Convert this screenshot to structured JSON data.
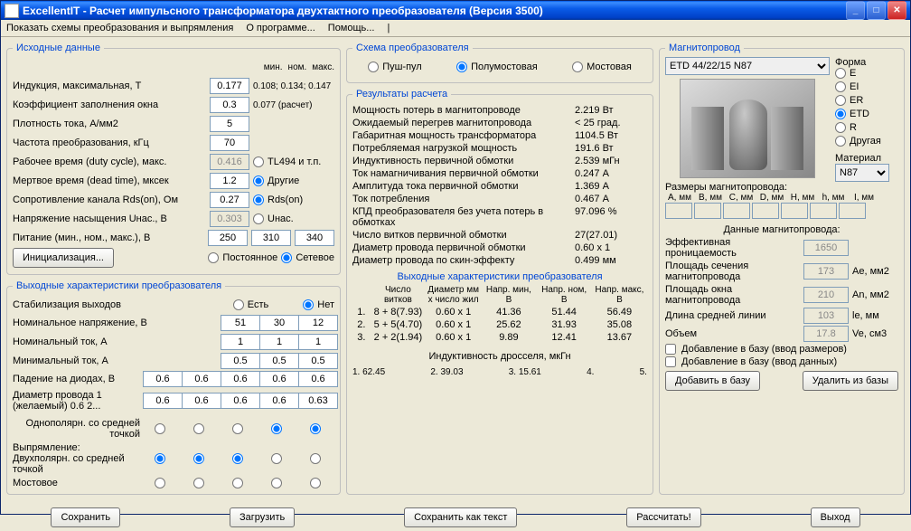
{
  "window": {
    "title": "ExcellentIT - Расчет импульсного трансформатора двухтактного преобразователя (Версия 3500)"
  },
  "menu": {
    "schemes": "Показать схемы преобразования и выпрямления",
    "about": "О программе...",
    "help": "Помощь...",
    "sep": "|"
  },
  "input": {
    "legend": "Исходные данные",
    "mm_header": {
      "min": "мин.",
      "nom": "ном.",
      "max": "макс."
    },
    "induction_l": "Индукция, максимальная, Т",
    "induction_v": "0.177",
    "induction_hint": "0.108; 0.134; 0.147",
    "fill_l": "Коэффициент заполнения окна",
    "fill_v": "0.3",
    "fill_hint": "0.077 (расчет)",
    "density_l": "Плотность тока, А/мм2",
    "density_v": "5",
    "freq_l": "Частота преобразования, кГц",
    "freq_v": "70",
    "duty_l": "Рабочее время (duty cycle), макс.",
    "duty_v": "0.416",
    "duty_r1": "TL494 и т.п.",
    "dead_l": "Мертвое время (dead time), мксек",
    "dead_v": "1.2",
    "dead_r1": "Другие",
    "rds_l": "Сопротивление канала Rds(on), Ом",
    "rds_v": "0.27",
    "rds_r1": "Rds(on)",
    "unas_l": "Напряжение насыщения Uнас., В",
    "unas_v": "0.303",
    "unas_r1": "Uнас.",
    "supply_l": "Питание (мин., ном., макс.), В",
    "supply_min": "250",
    "supply_nom": "310",
    "supply_max": "340",
    "init_btn": "Инициализация...",
    "const_r": "Постоянное",
    "mains_r": "Сетевое"
  },
  "out": {
    "legend": "Выходные характеристики преобразователя",
    "stab_l": "Стабилизация выходов",
    "stab_yes": "Есть",
    "stab_no": "Нет",
    "vnom_l": "Номинальное напряжение, В",
    "vnom": [
      "51",
      "30",
      "12"
    ],
    "inom_l": "Номинальный ток, А",
    "inom": [
      "1",
      "1",
      "1"
    ],
    "imin_l": "Минимальный ток, А",
    "imin": [
      "0.5",
      "0.5",
      "0.5"
    ],
    "vdrop_l": "Падение на диодах, В",
    "vdrop": [
      "0.6",
      "0.6",
      "0.6",
      "0.6",
      "0.6"
    ],
    "wire_l": "Диаметр провода 1 (желаемый)",
    "wire_l2": "0.6 2...",
    "wire": [
      "0.6",
      "0.6",
      "0.6",
      "0.6",
      "0.63"
    ],
    "rect_l": "Выпрямление:",
    "r1": "Однополярн. со средней точкой",
    "r2": "Двухполярн. со средней точкой",
    "r3": "Мостовое"
  },
  "scheme": {
    "legend": "Схема преобразователя",
    "push": "Пуш-пул",
    "half": "Полумостовая",
    "bridge": "Мостовая"
  },
  "results": {
    "legend": "Результаты расчета",
    "rows": [
      {
        "l": "Мощность потерь в магнитопроводе",
        "v": "2.219 Вт"
      },
      {
        "l": "Ожидаемый перегрев магнитопровода",
        "v": "< 25 град."
      },
      {
        "l": "Габаритная мощность трансформатора",
        "v": "1104.5 Вт"
      },
      {
        "l": "Потребляемая нагрузкой мощность",
        "v": "191.6 Вт"
      },
      {
        "l": "Индуктивность первичной обмотки",
        "v": "2.539 мГн"
      },
      {
        "l": "Ток намагничивания первичной обмотки",
        "v": "0.247 А"
      },
      {
        "l": "Амплитуда тока первичной обмотки",
        "v": "1.369 А"
      },
      {
        "l": "Ток потребления",
        "v": "0.467 А"
      },
      {
        "l": "КПД преобразователя без учета потерь в обмотках",
        "v": "97.096 %"
      },
      {
        "l": "Число витков первичной обмотки",
        "v": "27(27.01)"
      },
      {
        "l": "Диаметр провода первичной обмотки",
        "v": "0.60 x 1"
      },
      {
        "l": "Диаметр провода по скин-эффекту",
        "v": "0.499 мм"
      }
    ],
    "legend2": "Выходные характеристики преобразователя",
    "th": [
      "",
      "Число витков",
      "Диаметр мм x число жил",
      "Напр. мин, В",
      "Напр. ном, В",
      "Напр. макс, В"
    ],
    "tr": [
      [
        "1.",
        "8 + 8(7.93)",
        "0.60 x 1",
        "41.36",
        "51.44",
        "56.49"
      ],
      [
        "2.",
        "5 + 5(4.70)",
        "0.60 x 1",
        "25.62",
        "31.93",
        "35.08"
      ],
      [
        "3.",
        "2 + 2(1.94)",
        "0.60 x 1",
        "9.89",
        "12.41",
        "13.67"
      ]
    ],
    "choke_l": "Индуктивность дросселя, мкГн",
    "choke": [
      "1. 62.45",
      "2. 39.03",
      "3. 15.61",
      "4.",
      "5."
    ]
  },
  "core": {
    "legend": "Магнитопровод",
    "select": "ETD 44/22/15 N87",
    "shape_l": "Форма",
    "shapes": [
      "E",
      "EI",
      "ER",
      "ETD",
      "R",
      "Другая"
    ],
    "shape_sel": "ETD",
    "mat_l": "Материал",
    "mat_v": "N87",
    "sizes_l": "Размеры магнитопровода:",
    "sizes_h": [
      "A, мм",
      "B, мм",
      "C, мм",
      "D, мм",
      "H, мм",
      "h, мм",
      "I, мм"
    ],
    "data_l": "Данные магнитопровода:",
    "perm_l": "Эффективная проницаемость",
    "perm_v": "1650",
    "perm_u": "",
    "ae_l": "Площадь сечения магнитопровода",
    "ae_v": "173",
    "ae_u": "Ae, мм2",
    "an_l": "Площадь окна магнитопровода",
    "an_v": "210",
    "an_u": "An, мм2",
    "le_l": "Длина средней линии",
    "le_v": "103",
    "le_u": "le, мм",
    "ve_l": "Объем",
    "ve_v": "17.8",
    "ve_u": "Ve, см3",
    "chk1": "Добавление в базу (ввод размеров)",
    "chk2": "Добавление в базу (ввод данных)",
    "add_btn": "Добавить в базу",
    "del_btn": "Удалить из базы"
  },
  "foot": {
    "save": "Сохранить",
    "load": "Загрузить",
    "save_txt": "Сохранить как текст",
    "calc": "Рассчитать!",
    "exit": "Выход"
  }
}
